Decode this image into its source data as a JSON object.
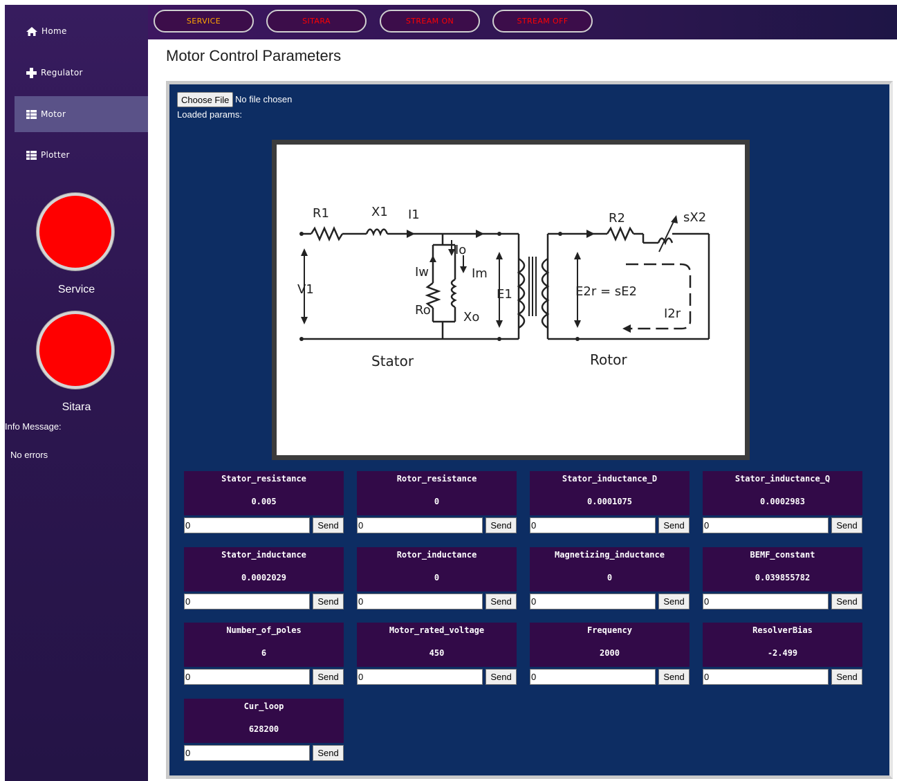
{
  "sidebar": {
    "items": [
      {
        "label": "Home",
        "icon": "home-icon"
      },
      {
        "label": "Regulator",
        "icon": "plus-icon"
      },
      {
        "label": "Motor",
        "icon": "list-icon"
      },
      {
        "label": "Plotter",
        "icon": "list-icon"
      }
    ],
    "active_item": "Motor",
    "indicators": [
      {
        "label": "Service",
        "color": "#ff0000"
      },
      {
        "label": "Sitara",
        "color": "#ff0000"
      }
    ],
    "info_label": "Info Message:",
    "info_message": "No errors"
  },
  "topbar": {
    "buttons": [
      {
        "label": "SERVICE",
        "color": "#ffa500"
      },
      {
        "label": "SITARA",
        "color": "#ff0000"
      },
      {
        "label": "STREAM ON",
        "color": "#ff0000"
      },
      {
        "label": "STREAM OFF",
        "color": "#ff0000"
      }
    ]
  },
  "page": {
    "title": "Motor Control Parameters",
    "choose_file_label": "Choose File",
    "file_status": "No file chosen",
    "loaded_params_label": "Loaded params:"
  },
  "diagram": {
    "labels": {
      "r1": "R1",
      "x1": "X1",
      "i1": "I1",
      "io": "Io",
      "iw": "Iw",
      "im": "Im",
      "ro": "Ro",
      "xo": "Xo",
      "v1": "V1",
      "e1": "E1",
      "r2": "R2",
      "sx2": "sX2",
      "e2r": "E2r = sE2",
      "i2r": "I2r",
      "stator": "Stator",
      "rotor": "Rotor"
    }
  },
  "params": [
    {
      "name": "Stator_resistance",
      "value": "0.005",
      "input": "0",
      "send": "Send"
    },
    {
      "name": "Rotor_resistance",
      "value": "0",
      "input": "0",
      "send": "Send"
    },
    {
      "name": "Stator_inductance_D",
      "value": "0.0001075",
      "input": "0",
      "send": "Send"
    },
    {
      "name": "Stator_inductance_Q",
      "value": "0.0002983",
      "input": "0",
      "send": "Send"
    },
    {
      "name": "Stator_inductance",
      "value": "0.0002029",
      "input": "0",
      "send": "Send"
    },
    {
      "name": "Rotor_inductance",
      "value": "0",
      "input": "0",
      "send": "Send"
    },
    {
      "name": "Magnetizing_inductance",
      "value": "0",
      "input": "0",
      "send": "Send"
    },
    {
      "name": "BEMF_constant",
      "value": "0.039855782",
      "input": "0",
      "send": "Send"
    },
    {
      "name": "Number_of_poles",
      "value": "6",
      "input": "0",
      "send": "Send"
    },
    {
      "name": "Motor_rated_voltage",
      "value": "450",
      "input": "0",
      "send": "Send"
    },
    {
      "name": "Frequency",
      "value": "2000",
      "input": "0",
      "send": "Send"
    },
    {
      "name": "ResolverBias",
      "value": "-2.499",
      "input": "0",
      "send": "Send"
    },
    {
      "name": "Cur_loop",
      "value": "628200",
      "input": "0",
      "send": "Send"
    }
  ]
}
